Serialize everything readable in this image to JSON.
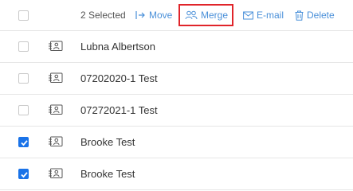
{
  "toolbar": {
    "selected_text": "2 Selected",
    "actions": {
      "move": "Move",
      "merge": "Merge",
      "email": "E-mail",
      "delete": "Delete"
    }
  },
  "contacts": [
    {
      "name": "Lubna Albertson",
      "checked": false
    },
    {
      "name": "07202020-1 Test",
      "checked": false
    },
    {
      "name": "07272021-1 Test",
      "checked": false
    },
    {
      "name": "Brooke Test",
      "checked": true
    },
    {
      "name": "Brooke Test",
      "checked": true
    }
  ],
  "colors": {
    "accent": "#4a90d9",
    "highlight": "#e0242a",
    "checkbox_checked": "#1a73e8"
  }
}
